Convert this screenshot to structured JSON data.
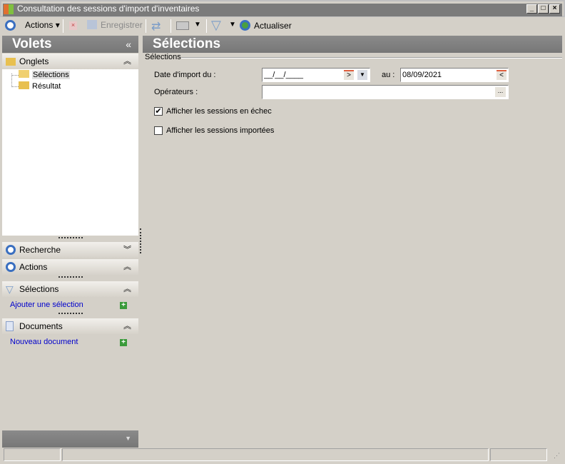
{
  "window": {
    "title": "Consultation des sessions d'import d'inventaires"
  },
  "toolbar": {
    "actions": "Actions",
    "save": "Enregistrer",
    "refresh": "Actualiser"
  },
  "left": {
    "title": "Volets",
    "collapse": "«",
    "tabs_header": "Onglets",
    "tree": [
      "Sélections",
      "Résultat"
    ],
    "sections": {
      "search": "Recherche",
      "actions": "Actions",
      "selections": "Sélections",
      "documents": "Documents"
    },
    "add_selection": "Ajouter une sélection",
    "new_document": "Nouveau document"
  },
  "main": {
    "title": "Sélections",
    "group": "Sélections",
    "date_label": "Date d'import du :",
    "date_from": "__/__/____",
    "to_label": "au :",
    "date_to": "08/09/2021",
    "operators_label": "Opérateurs :",
    "operators_value": "",
    "ellipsis": "...",
    "chk_failed": "Afficher les sessions en échec",
    "chk_failed_checked": true,
    "chk_imported": "Afficher les sessions importées",
    "chk_imported_checked": false
  }
}
